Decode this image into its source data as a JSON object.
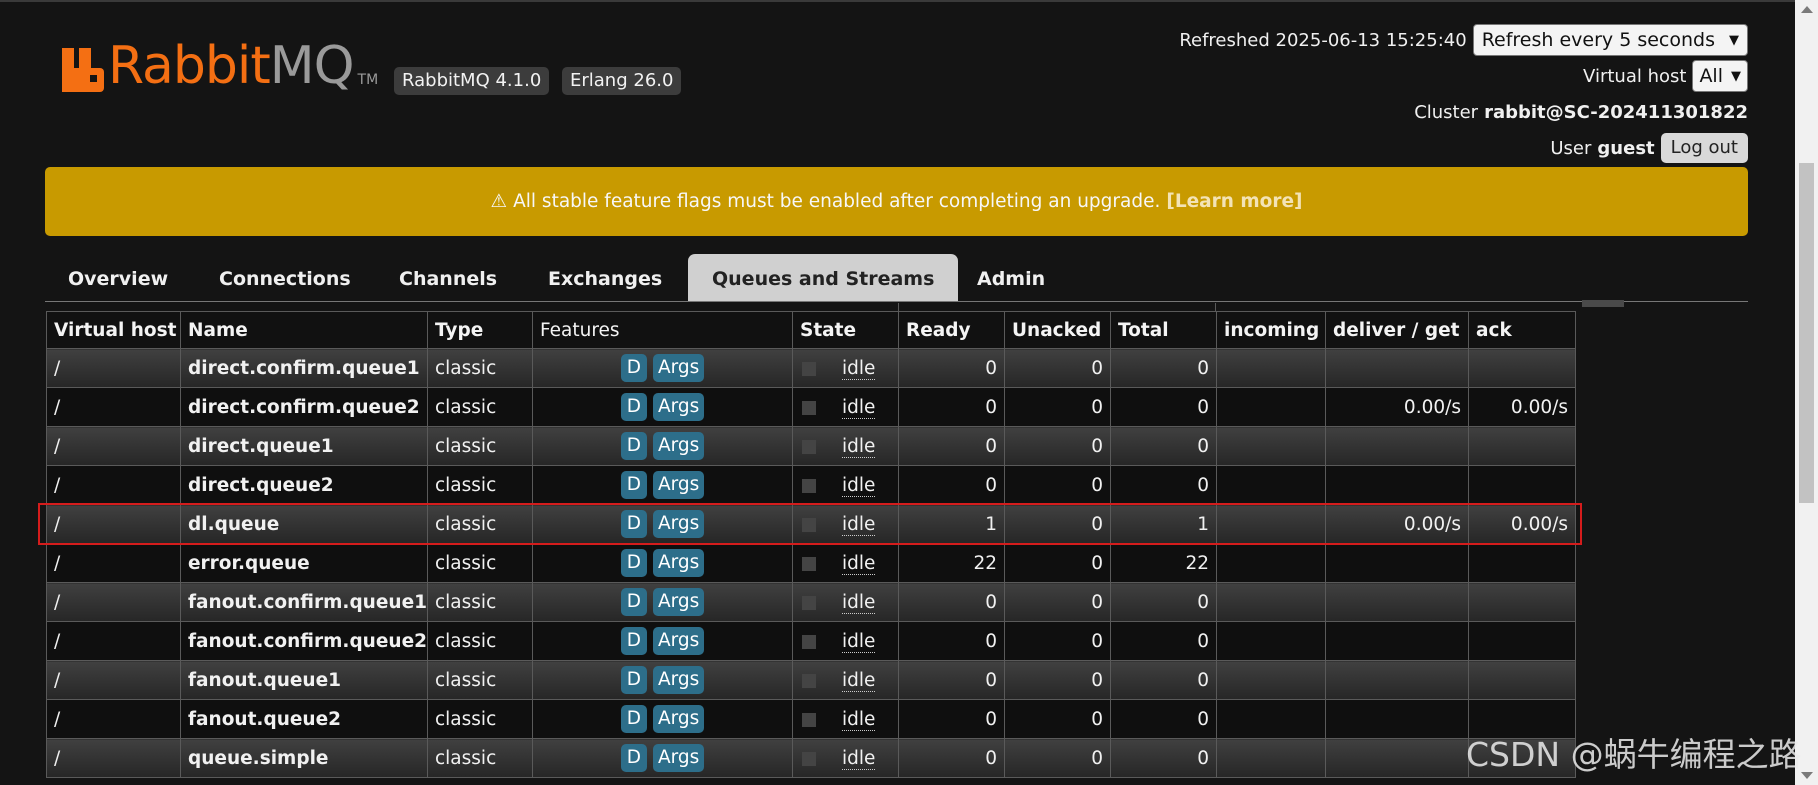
{
  "app": {
    "logo_rabbit": "Rabbit",
    "logo_mq": "MQ",
    "logo_tm": "TM",
    "version_badge": "RabbitMQ 4.1.0",
    "erlang_badge": "Erlang 26.0",
    "brand_color": "#f46f13"
  },
  "header": {
    "refreshed_label": "Refreshed 2025-06-13 15:25:40",
    "refresh_select": "Refresh every 5 seconds",
    "vhost_label": "Virtual host",
    "vhost_select": "All",
    "cluster_label": "Cluster",
    "cluster_name": "rabbit@SC-202411301822",
    "user_label": "User",
    "user_name": "guest",
    "logout_label": "Log out"
  },
  "warning": {
    "icon": "⚠",
    "text": "All stable feature flags must be enabled after completing an upgrade.",
    "link": "[Learn more]",
    "color": "#c89a00"
  },
  "tabs": [
    {
      "label": "Overview"
    },
    {
      "label": "Connections"
    },
    {
      "label": "Channels"
    },
    {
      "label": "Exchanges"
    },
    {
      "label": "Queues and Streams",
      "active": true
    },
    {
      "label": "Admin"
    }
  ],
  "table": {
    "headers": [
      "Virtual host",
      "Name",
      "Type",
      "Features",
      "State",
      "Ready",
      "Unacked",
      "Total",
      "incoming",
      "deliver / get",
      "ack"
    ],
    "rows": [
      {
        "vhost": "/",
        "name": "direct.confirm.queue1",
        "type": "classic",
        "d": "D",
        "args": "Args",
        "state": "idle",
        "ready": "0",
        "unacked": "0",
        "total": "0",
        "incoming": "",
        "deliver": "",
        "ack": ""
      },
      {
        "vhost": "/",
        "name": "direct.confirm.queue2",
        "type": "classic",
        "d": "D",
        "args": "Args",
        "state": "idle",
        "ready": "0",
        "unacked": "0",
        "total": "0",
        "incoming": "",
        "deliver": "0.00/s",
        "ack": "0.00/s"
      },
      {
        "vhost": "/",
        "name": "direct.queue1",
        "type": "classic",
        "d": "D",
        "args": "Args",
        "state": "idle",
        "ready": "0",
        "unacked": "0",
        "total": "0",
        "incoming": "",
        "deliver": "",
        "ack": ""
      },
      {
        "vhost": "/",
        "name": "direct.queue2",
        "type": "classic",
        "d": "D",
        "args": "Args",
        "state": "idle",
        "ready": "0",
        "unacked": "0",
        "total": "0",
        "incoming": "",
        "deliver": "",
        "ack": ""
      },
      {
        "vhost": "/",
        "name": "dl.queue",
        "type": "classic",
        "d": "D",
        "args": "Args",
        "state": "idle",
        "ready": "1",
        "unacked": "0",
        "total": "1",
        "incoming": "",
        "deliver": "0.00/s",
        "ack": "0.00/s"
      },
      {
        "vhost": "/",
        "name": "error.queue",
        "type": "classic",
        "d": "D",
        "args": "Args",
        "state": "idle",
        "ready": "22",
        "unacked": "0",
        "total": "22",
        "incoming": "",
        "deliver": "",
        "ack": ""
      },
      {
        "vhost": "/",
        "name": "fanout.confirm.queue1",
        "type": "classic",
        "d": "D",
        "args": "Args",
        "state": "idle",
        "ready": "0",
        "unacked": "0",
        "total": "0",
        "incoming": "",
        "deliver": "",
        "ack": ""
      },
      {
        "vhost": "/",
        "name": "fanout.confirm.queue2",
        "type": "classic",
        "d": "D",
        "args": "Args",
        "state": "idle",
        "ready": "0",
        "unacked": "0",
        "total": "0",
        "incoming": "",
        "deliver": "",
        "ack": ""
      },
      {
        "vhost": "/",
        "name": "fanout.queue1",
        "type": "classic",
        "d": "D",
        "args": "Args",
        "state": "idle",
        "ready": "0",
        "unacked": "0",
        "total": "0",
        "incoming": "",
        "deliver": "",
        "ack": ""
      },
      {
        "vhost": "/",
        "name": "fanout.queue2",
        "type": "classic",
        "d": "D",
        "args": "Args",
        "state": "idle",
        "ready": "0",
        "unacked": "0",
        "total": "0",
        "incoming": "",
        "deliver": "",
        "ack": ""
      },
      {
        "vhost": "/",
        "name": "queue.simple",
        "type": "classic",
        "d": "D",
        "args": "Args",
        "state": "idle",
        "ready": "0",
        "unacked": "0",
        "total": "0",
        "incoming": "",
        "deliver": "",
        "ack": ""
      }
    ]
  },
  "watermark": "CSDN @蜗牛编程之路"
}
